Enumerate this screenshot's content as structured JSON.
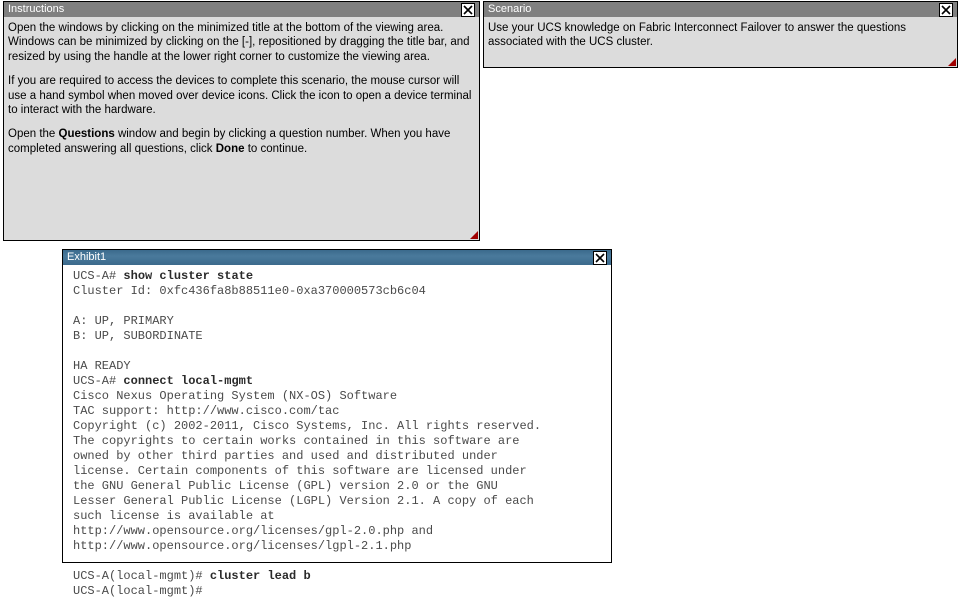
{
  "instructions": {
    "title": "Instructions",
    "p1": "Open the windows by clicking on the minimized title at the bottom of the viewing area. Windows can be minimized by clicking on the [-], repositioned by dragging the title bar, and resized by using the handle at the lower right corner to customize the viewing area.",
    "p2": "If you are required to access the devices to complete this scenario, the mouse cursor will use a hand symbol when moved over device icons. Click the icon to open a device terminal to interact with the hardware.",
    "p3_a": "Open the ",
    "p3_bold1": "Questions",
    "p3_b": " window and begin by clicking a question number. When you have completed answering all questions, click ",
    "p3_bold2": "Done",
    "p3_c": " to continue."
  },
  "scenario": {
    "title": "Scenario",
    "text": "Use your UCS knowledge on Fabric Interconnect Failover to answer the questions associated with the UCS cluster."
  },
  "exhibit": {
    "title": "Exhibit1",
    "prompt1": "UCS-A# ",
    "cmd1": "show cluster state",
    "cluster_id_line": "Cluster Id: 0xfc436fa8b88511e0-0xa370000573cb6c04",
    "blank": "",
    "a_line": "A: UP, PRIMARY",
    "b_line": "B: UP, SUBORDINATE",
    "ha_line": "HA READY",
    "prompt2": "UCS-A# ",
    "cmd2": "connect local-mgmt",
    "os_line": "Cisco Nexus Operating System (NX-OS) Software",
    "tac_line": "TAC support: http://www.cisco.com/tac",
    "copyright_a": "Copyright (c) 2002-2011, Cisco Systems, Inc. All rights reserved.",
    "copyright_b": "The copyrights to certain works contained in this software are",
    "copyright_c": "owned by other third parties and used and distributed under",
    "copyright_d": "license. Certain components of this software are licensed under",
    "copyright_e": "the GNU General Public License (GPL) version 2.0 or the GNU",
    "copyright_f": "Lesser General Public License (LGPL) Version 2.1. A copy of each",
    "copyright_g": "such license is available at",
    "url1": "http://www.opensource.org/licenses/gpl-2.0.php and",
    "url2": "http://www.opensource.org/licenses/lgpl-2.1.php",
    "prompt3": "UCS-A(local-mgmt)# ",
    "cmd3": "cluster lead b",
    "prompt4": "UCS-A(local-mgmt)#"
  }
}
